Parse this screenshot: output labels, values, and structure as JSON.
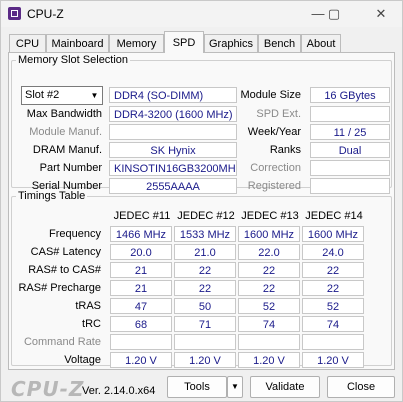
{
  "window": {
    "title": "CPU-Z",
    "minimize": "—",
    "maximize": "▢",
    "close": "✕"
  },
  "tabs": [
    "CPU",
    "Mainboard",
    "Memory",
    "SPD",
    "Graphics",
    "Bench",
    "About"
  ],
  "active_tab": "SPD",
  "slot": {
    "section_title": "Memory Slot Selection",
    "selected": "Slot #2",
    "type": "DDR4 (SO-DIMM)",
    "module_size_label": "Module Size",
    "module_size": "16 GBytes",
    "max_bandwidth_label": "Max Bandwidth",
    "max_bandwidth": "DDR4-3200 (1600 MHz)",
    "spd_ext_label": "SPD Ext.",
    "spd_ext": "",
    "module_manuf_label": "Module Manuf.",
    "module_manuf": "",
    "week_year_label": "Week/Year",
    "week_year": "11 / 25",
    "dram_manuf_label": "DRAM Manuf.",
    "dram_manuf": "SK Hynix",
    "ranks_label": "Ranks",
    "ranks": "Dual",
    "part_number_label": "Part Number",
    "part_number": "KINSOTIN16GB3200MHZ",
    "correction_label": "Correction",
    "correction": "",
    "serial_number_label": "Serial Number",
    "serial_number": "2555AAAA",
    "registered_label": "Registered",
    "registered": ""
  },
  "timings": {
    "section_title": "Timings Table",
    "columns": [
      "JEDEC #11",
      "JEDEC #12",
      "JEDEC #13",
      "JEDEC #14"
    ],
    "rows": [
      {
        "label": "Frequency",
        "values": [
          "1466 MHz",
          "1533 MHz",
          "1600 MHz",
          "1600 MHz"
        ]
      },
      {
        "label": "CAS# Latency",
        "values": [
          "20.0",
          "21.0",
          "22.0",
          "24.0"
        ]
      },
      {
        "label": "RAS# to CAS#",
        "values": [
          "21",
          "22",
          "22",
          "22"
        ]
      },
      {
        "label": "RAS# Precharge",
        "values": [
          "21",
          "22",
          "22",
          "22"
        ]
      },
      {
        "label": "tRAS",
        "values": [
          "47",
          "50",
          "52",
          "52"
        ]
      },
      {
        "label": "tRC",
        "values": [
          "68",
          "71",
          "74",
          "74"
        ]
      },
      {
        "label": "Command Rate",
        "values": [
          "",
          "",
          "",
          ""
        ]
      },
      {
        "label": "Voltage",
        "values": [
          "1.20 V",
          "1.20 V",
          "1.20 V",
          "1.20 V"
        ]
      }
    ]
  },
  "footer": {
    "logo": "CPU-Z",
    "version": "Ver. 2.14.0.x64",
    "tools_label": "Tools",
    "tools_arrow": "▼",
    "validate_label": "Validate",
    "close_label": "Close"
  }
}
